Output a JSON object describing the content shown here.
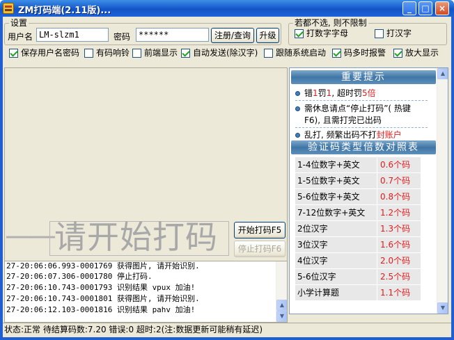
{
  "window": {
    "title": "ZM打码端(2.11版)...",
    "controls": {
      "minimize": "_",
      "maximize": "□",
      "close": "×"
    }
  },
  "settings": {
    "legend": "设置",
    "username_label": "用户名",
    "username_value": "LM-slzm1",
    "password_label": "密码",
    "password_value": "******",
    "register_button": "注册/查询",
    "upgrade_button": "升级"
  },
  "limits": {
    "legend": "若都不选, 则不限制",
    "options": [
      {
        "label": "打数字字母",
        "checked": true
      },
      {
        "label": "打汉字",
        "checked": false
      }
    ]
  },
  "options_row": [
    {
      "label": "保存用户名密码",
      "checked": true
    },
    {
      "label": "有码响铃",
      "checked": false
    },
    {
      "label": "前端显示",
      "checked": false
    },
    {
      "label": "自动发送(除汉字)",
      "checked": true
    },
    {
      "label": "跟随系统启动",
      "checked": false
    },
    {
      "label": "码多时报警",
      "checked": true
    },
    {
      "label": "放大显示",
      "checked": true
    }
  ],
  "captcha": {
    "dash": "——",
    "placeholder": "请开始打码",
    "start_button": "开始打码F5",
    "stop_button": "停止打码F6"
  },
  "log": [
    "27-20:06:06.993-0001769 获得图片, 请开始识别.",
    "27-20:06:07.306-0001780 停止打码.",
    "27-20:06:10.743-0001793 识别结果 vpux 加油!",
    "27-20:06:10.743-0001801 获得图片, 请开始识别.",
    "27-20:06:12.103-0001816 识别结果 pahv 加油!"
  ],
  "tips": {
    "header": "重要提示",
    "items": [
      {
        "parts": [
          "错",
          "1",
          "罚",
          "1",
          ", 超时罚",
          "5倍"
        ]
      },
      {
        "lines": [
          "需休息请点“停止打码”( 热键",
          "F6), 且需打完已出码"
        ]
      },
      {
        "parts": [
          "乱打, 频繁出码不打",
          "封账户"
        ]
      }
    ]
  },
  "table": {
    "header": "验证码类型倍数对照表",
    "rows": [
      {
        "type": "1-4位数字+英文",
        "value": "0.6个码"
      },
      {
        "type": "1-5位数字+英文",
        "value": "0.7个码"
      },
      {
        "type": "5-6位数字+英文",
        "value": "0.8个码"
      },
      {
        "type": "7-12位数字+英文",
        "value": "1.2个码"
      },
      {
        "type": "2位汉字",
        "value": "1.3个码"
      },
      {
        "type": "3位汉字",
        "value": "1.6个码"
      },
      {
        "type": "4位汉字",
        "value": "2.0个码"
      },
      {
        "type": "5-6位汉字",
        "value": "2.5个码"
      },
      {
        "type": "小学计算题",
        "value": "1.1个码"
      }
    ]
  },
  "status": "状态:正常 待结算码数:7.20 错误:0 超时:2(注:数据更新可能稍有延迟)",
  "colors": {
    "title_bar": "#1253c5",
    "accent_red": "#e01b1b",
    "header_blue": "#3f76a8"
  },
  "icons": [
    "app-icon",
    "checkmark-icon",
    "bullet-icon",
    "scroll-up-icon",
    "scroll-down-icon"
  ]
}
